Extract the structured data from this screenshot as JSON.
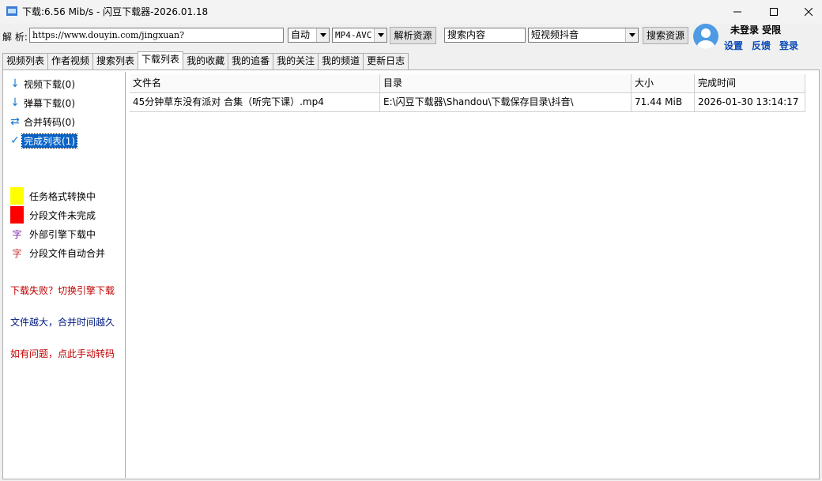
{
  "window": {
    "title": "下载:6.56 Mib/s - 闪豆下载器-2026.01.18"
  },
  "toolbar": {
    "parse_label": "解 析:",
    "url_value": "https://www.douyin.com/jingxuan?",
    "quality_selected": "自动",
    "format_selected": "MP4-AVC",
    "parse_button": "解析资源",
    "search_value": "搜索内容",
    "platform_selected": "短视频抖音",
    "search_button": "搜索资源"
  },
  "user": {
    "status": "未登录  受限",
    "settings": "设置",
    "feedback": "反馈",
    "login": "登录"
  },
  "tabs": [
    {
      "label": "视频列表"
    },
    {
      "label": "作者视频"
    },
    {
      "label": "搜索列表"
    },
    {
      "label": "下载列表",
      "active": true
    },
    {
      "label": "我的收藏"
    },
    {
      "label": "我的追番"
    },
    {
      "label": "我的关注"
    },
    {
      "label": "我的频道"
    },
    {
      "label": "更新日志"
    }
  ],
  "sidebar": {
    "items": [
      {
        "label": "视频下载(0)",
        "icon": "arrow-down-icon"
      },
      {
        "label": "弹幕下载(0)",
        "icon": "arrow-down-icon"
      },
      {
        "label": "合并转码(0)",
        "icon": "swap-icon"
      },
      {
        "label": "完成列表(1)",
        "icon": "check-icon",
        "selected": true
      }
    ],
    "legend": [
      {
        "label": "任务格式转换中",
        "color": "#ffff00"
      },
      {
        "label": "分段文件未完成",
        "color": "#ff0000"
      },
      {
        "label": "外部引擎下载中",
        "glyph": "字",
        "color": "#7b1fa2"
      },
      {
        "label": "分段文件自动合并",
        "glyph": "字",
        "color": "#c62828"
      }
    ],
    "notes": [
      {
        "text": "下载失败？切换引擎下载",
        "color": "#c00000"
      },
      {
        "text": "文件越大，合并时间越久",
        "color": "#001a80"
      },
      {
        "text": "如有问题，点此手动转码",
        "color": "#c00000"
      }
    ]
  },
  "table": {
    "columns": [
      "文件名",
      "目录",
      "大小",
      "完成时间"
    ],
    "rows": [
      [
        "45分钟草东没有派对  合集（听完下课）.mp4",
        "E:\\闪豆下载器\\Shandou\\下载保存目录\\抖音\\",
        "71.44 MiB",
        "2026-01-30 13:14:17"
      ]
    ]
  }
}
